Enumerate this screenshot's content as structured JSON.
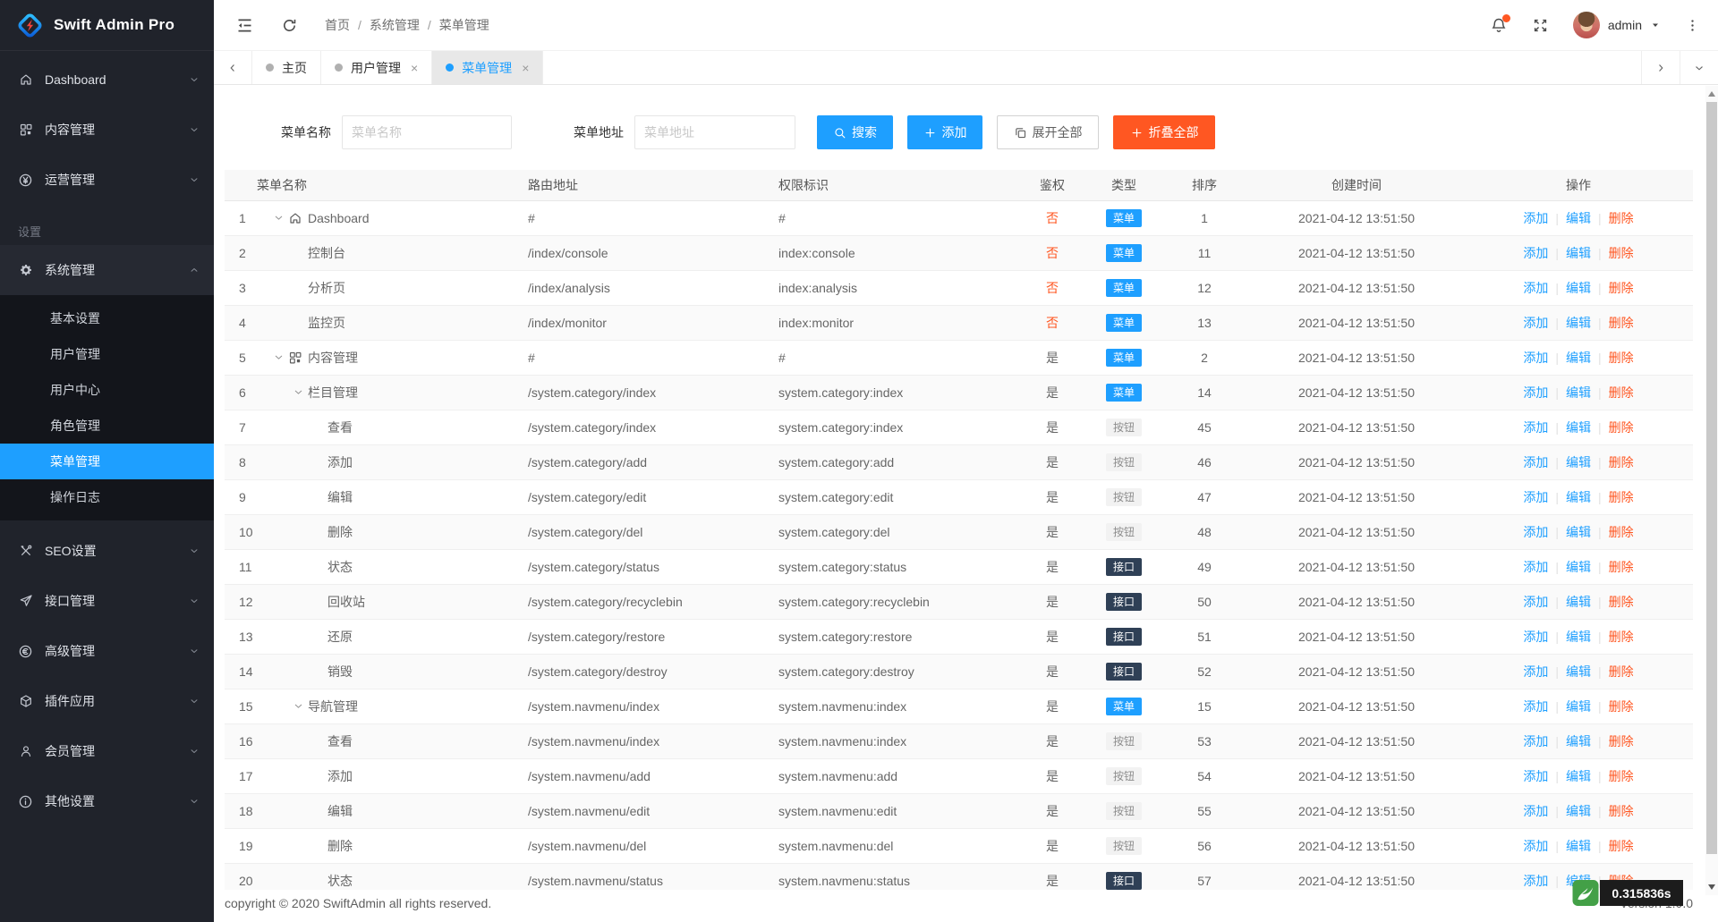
{
  "app": {
    "logo_title": "Swift Admin Pro"
  },
  "topbar": {
    "breadcrumb": [
      "首页",
      "系统管理",
      "菜单管理"
    ],
    "username": "admin"
  },
  "tabs": [
    {
      "id": "home",
      "label": "主页",
      "closable": false,
      "active": false
    },
    {
      "id": "user-mgmt",
      "label": "用户管理",
      "closable": true,
      "active": false
    },
    {
      "id": "menu-mgmt",
      "label": "菜单管理",
      "closable": true,
      "active": true
    }
  ],
  "sidebar": {
    "menu": [
      {
        "type": "item",
        "id": "dashboard",
        "label": "Dashboard",
        "icon": "home-icon"
      },
      {
        "type": "item",
        "id": "content",
        "label": "内容管理",
        "icon": "grid-icon"
      },
      {
        "type": "item",
        "id": "operation",
        "label": "运营管理",
        "icon": "yen-icon"
      },
      {
        "type": "section",
        "id": "settings-section",
        "label": "设置"
      },
      {
        "type": "item",
        "id": "system",
        "label": "系统管理",
        "icon": "gear-icon",
        "expanded": true,
        "children": [
          {
            "id": "basic-settings",
            "label": "基本设置",
            "active": false
          },
          {
            "id": "user-mgmt",
            "label": "用户管理",
            "active": false
          },
          {
            "id": "user-center",
            "label": "用户中心",
            "active": false
          },
          {
            "id": "role-mgmt",
            "label": "角色管理",
            "active": false
          },
          {
            "id": "menu-mgmt",
            "label": "菜单管理",
            "active": true
          },
          {
            "id": "op-logs",
            "label": "操作日志",
            "active": false
          }
        ]
      },
      {
        "type": "item",
        "id": "seo",
        "label": "SEO设置",
        "icon": "tools-icon"
      },
      {
        "type": "item",
        "id": "api",
        "label": "接口管理",
        "icon": "send-icon"
      },
      {
        "type": "item",
        "id": "advanced",
        "label": "高级管理",
        "icon": "euro-icon"
      },
      {
        "type": "item",
        "id": "plugins",
        "label": "插件应用",
        "icon": "cube-icon"
      },
      {
        "type": "item",
        "id": "members",
        "label": "会员管理",
        "icon": "member-icon"
      },
      {
        "type": "item",
        "id": "other",
        "label": "其他设置",
        "icon": "info-icon"
      }
    ]
  },
  "search_form": {
    "fields": [
      {
        "id": "menu-name",
        "label": "菜单名称",
        "placeholder": "菜单名称",
        "value": ""
      },
      {
        "id": "menu-address",
        "label": "菜单地址",
        "placeholder": "菜单地址",
        "value": ""
      }
    ],
    "buttons": [
      {
        "id": "search",
        "label": "搜索",
        "icon": "search-icon",
        "style": "primary"
      },
      {
        "id": "add",
        "label": "添加",
        "icon": "plus-icon",
        "style": "primary"
      },
      {
        "id": "expand-all",
        "label": "展开全部",
        "icon": "expand-all-icon",
        "style": "default"
      },
      {
        "id": "collapse-all",
        "label": "折叠全部",
        "icon": "plus-icon",
        "style": "warm"
      }
    ]
  },
  "table": {
    "columns": [
      "菜单名称",
      "路由地址",
      "权限标识",
      "鉴权",
      "类型",
      "排序",
      "创建时间",
      "操作"
    ],
    "row_actions": [
      "添加",
      "编辑",
      "删除"
    ],
    "type_styles": {
      "菜单": "blue",
      "按钮": "gray",
      "接口": "dark"
    },
    "rows": [
      {
        "index": 1,
        "level": 0,
        "expandable": true,
        "icon": "home-icon",
        "name": "Dashboard",
        "route": "#",
        "perm": "#",
        "auth": "否",
        "type": "菜单",
        "sort": 1,
        "created": "2021-04-12 13:51:50"
      },
      {
        "index": 2,
        "level": 1,
        "expandable": false,
        "icon": "",
        "name": "控制台",
        "route": "/index/console",
        "perm": "index:console",
        "auth": "否",
        "type": "菜单",
        "sort": 11,
        "created": "2021-04-12 13:51:50"
      },
      {
        "index": 3,
        "level": 1,
        "expandable": false,
        "icon": "",
        "name": "分析页",
        "route": "/index/analysis",
        "perm": "index:analysis",
        "auth": "否",
        "type": "菜单",
        "sort": 12,
        "created": "2021-04-12 13:51:50"
      },
      {
        "index": 4,
        "level": 1,
        "expandable": false,
        "icon": "",
        "name": "监控页",
        "route": "/index/monitor",
        "perm": "index:monitor",
        "auth": "否",
        "type": "菜单",
        "sort": 13,
        "created": "2021-04-12 13:51:50"
      },
      {
        "index": 5,
        "level": 0,
        "expandable": true,
        "icon": "grid-icon",
        "name": "内容管理",
        "route": "#",
        "perm": "#",
        "auth": "是",
        "type": "菜单",
        "sort": 2,
        "created": "2021-04-12 13:51:50"
      },
      {
        "index": 6,
        "level": 1,
        "expandable": true,
        "icon": "",
        "name": "栏目管理",
        "route": "/system.category/index",
        "perm": "system.category:index",
        "auth": "是",
        "type": "菜单",
        "sort": 14,
        "created": "2021-04-12 13:51:50"
      },
      {
        "index": 7,
        "level": 2,
        "expandable": false,
        "icon": "",
        "name": "查看",
        "route": "/system.category/index",
        "perm": "system.category:index",
        "auth": "是",
        "type": "按钮",
        "sort": 45,
        "created": "2021-04-12 13:51:50"
      },
      {
        "index": 8,
        "level": 2,
        "expandable": false,
        "icon": "",
        "name": "添加",
        "route": "/system.category/add",
        "perm": "system.category:add",
        "auth": "是",
        "type": "按钮",
        "sort": 46,
        "created": "2021-04-12 13:51:50"
      },
      {
        "index": 9,
        "level": 2,
        "expandable": false,
        "icon": "",
        "name": "编辑",
        "route": "/system.category/edit",
        "perm": "system.category:edit",
        "auth": "是",
        "type": "按钮",
        "sort": 47,
        "created": "2021-04-12 13:51:50"
      },
      {
        "index": 10,
        "level": 2,
        "expandable": false,
        "icon": "",
        "name": "删除",
        "route": "/system.category/del",
        "perm": "system.category:del",
        "auth": "是",
        "type": "按钮",
        "sort": 48,
        "created": "2021-04-12 13:51:50"
      },
      {
        "index": 11,
        "level": 2,
        "expandable": false,
        "icon": "",
        "name": "状态",
        "route": "/system.category/status",
        "perm": "system.category:status",
        "auth": "是",
        "type": "接口",
        "sort": 49,
        "created": "2021-04-12 13:51:50"
      },
      {
        "index": 12,
        "level": 2,
        "expandable": false,
        "icon": "",
        "name": "回收站",
        "route": "/system.category/recyclebin",
        "perm": "system.category:recyclebin",
        "auth": "是",
        "type": "接口",
        "sort": 50,
        "created": "2021-04-12 13:51:50"
      },
      {
        "index": 13,
        "level": 2,
        "expandable": false,
        "icon": "",
        "name": "还原",
        "route": "/system.category/restore",
        "perm": "system.category:restore",
        "auth": "是",
        "type": "接口",
        "sort": 51,
        "created": "2021-04-12 13:51:50"
      },
      {
        "index": 14,
        "level": 2,
        "expandable": false,
        "icon": "",
        "name": "销毁",
        "route": "/system.category/destroy",
        "perm": "system.category:destroy",
        "auth": "是",
        "type": "接口",
        "sort": 52,
        "created": "2021-04-12 13:51:50"
      },
      {
        "index": 15,
        "level": 1,
        "expandable": true,
        "icon": "",
        "name": "导航管理",
        "route": "/system.navmenu/index",
        "perm": "system.navmenu:index",
        "auth": "是",
        "type": "菜单",
        "sort": 15,
        "created": "2021-04-12 13:51:50"
      },
      {
        "index": 16,
        "level": 2,
        "expandable": false,
        "icon": "",
        "name": "查看",
        "route": "/system.navmenu/index",
        "perm": "system.navmenu:index",
        "auth": "是",
        "type": "按钮",
        "sort": 53,
        "created": "2021-04-12 13:51:50"
      },
      {
        "index": 17,
        "level": 2,
        "expandable": false,
        "icon": "",
        "name": "添加",
        "route": "/system.navmenu/add",
        "perm": "system.navmenu:add",
        "auth": "是",
        "type": "按钮",
        "sort": 54,
        "created": "2021-04-12 13:51:50"
      },
      {
        "index": 18,
        "level": 2,
        "expandable": false,
        "icon": "",
        "name": "编辑",
        "route": "/system.navmenu/edit",
        "perm": "system.navmenu:edit",
        "auth": "是",
        "type": "按钮",
        "sort": 55,
        "created": "2021-04-12 13:51:50"
      },
      {
        "index": 19,
        "level": 2,
        "expandable": false,
        "icon": "",
        "name": "删除",
        "route": "/system.navmenu/del",
        "perm": "system.navmenu:del",
        "auth": "是",
        "type": "按钮",
        "sort": 56,
        "created": "2021-04-12 13:51:50"
      },
      {
        "index": 20,
        "level": 2,
        "expandable": false,
        "icon": "",
        "name": "状态",
        "route": "/system.navmenu/status",
        "perm": "system.navmenu:status",
        "auth": "是",
        "type": "接口",
        "sort": 57,
        "created": "2021-04-12 13:51:50"
      }
    ]
  },
  "footer": {
    "copyright": "copyright © 2020 SwiftAdmin all rights reserved.",
    "version": "Version 1.0.0"
  },
  "debug": {
    "time": "0.315836s"
  },
  "colors": {
    "primary": "#1E9FFF",
    "warm": "#FF5722",
    "danger": "#FF5722",
    "badge_dark": "#2F4056",
    "sidebar_bg": "#20232b",
    "active_menu": "#1E9FFF"
  }
}
